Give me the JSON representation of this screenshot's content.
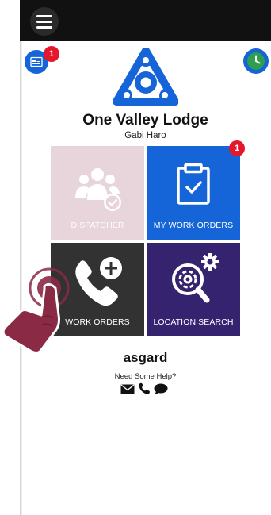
{
  "header": {
    "menu_icon": "hamburger-menu-icon"
  },
  "top_actions": {
    "news_icon": "newspaper-icon",
    "news_badge": "1",
    "clock_icon": "clock-icon"
  },
  "organization": {
    "name": "One Valley Lodge",
    "user": "Gabi Haro"
  },
  "tiles": [
    {
      "label": "DISPATCHER",
      "icon": "users-check-icon",
      "enabled": false
    },
    {
      "label": "MY WORK ORDERS",
      "icon": "clipboard-check-icon",
      "badge": "1",
      "enabled": true
    },
    {
      "label": "WORK ORDERS",
      "icon": "phone-plus-icon",
      "enabled": true
    },
    {
      "label": "LOCATION SEARCH",
      "icon": "gear-search-icon",
      "enabled": true
    }
  ],
  "footer": {
    "brand": "asgard",
    "help_text": "Need Some Help?",
    "contact_icons": [
      "envelope-icon",
      "phone-icon",
      "chat-icon"
    ]
  },
  "colors": {
    "topbar": "#111111",
    "accent_blue": "#1565d8",
    "disabled_tile": "#e8d4db",
    "dark_tile": "#323232",
    "purple_tile": "#36236f",
    "badge_red": "#e3182d",
    "clock_green": "#2e9e4f",
    "pointer_hand": "#8b2a45"
  }
}
